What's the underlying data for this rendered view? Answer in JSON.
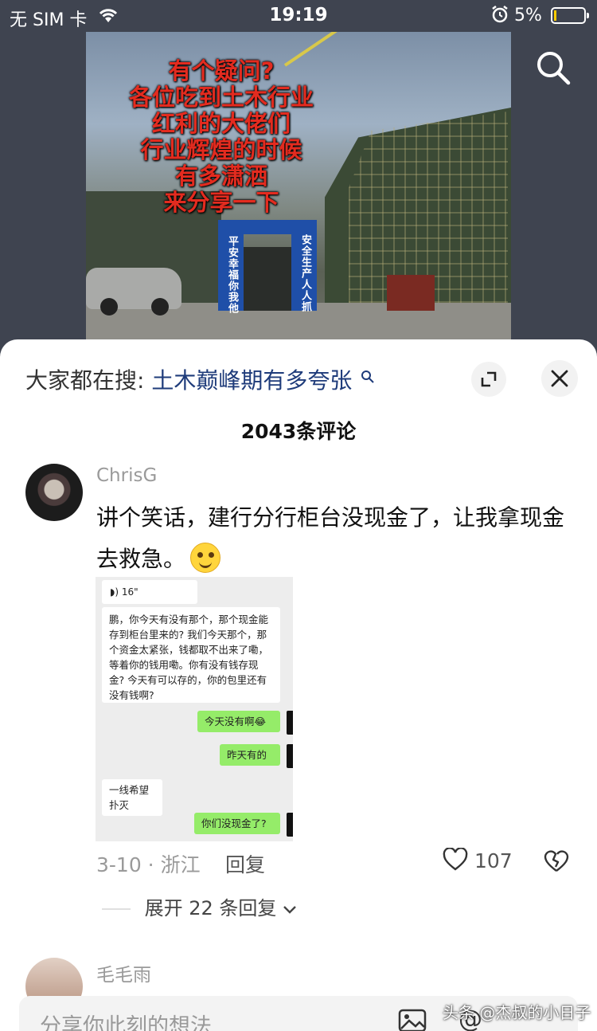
{
  "status_bar": {
    "carrier": "无 SIM 卡",
    "time": "19:19",
    "battery": "5%"
  },
  "post_image": {
    "overlay_lines": [
      "有个疑问?",
      "各位吃到土木行业",
      "红利的大佬们",
      "行业辉煌的时候",
      "有多潇洒",
      "来分享一下"
    ],
    "gate_left": "平安幸福你我他",
    "gate_right": "安全生产人人抓"
  },
  "sheet": {
    "search_prefix": "大家都在搜:",
    "search_term": "土木巅峰期有多夸张",
    "comment_count": "2043条评论"
  },
  "comment": {
    "username": "ChrisG",
    "text": "讲个笑话，建行分行柜台没现金了，让我拿现金去救急。",
    "date_location": "3-10 · 浙江",
    "reply_label": "回复",
    "likes": "107",
    "expand_replies": "展开 22 条回复"
  },
  "chat_screenshot": {
    "voice": "16\"",
    "message_1": "鹏，你今天有没有那个，那个现金能存到柜台里来的? 我们今天那个，那个资金太紧张，钱都取不出来了嘞，等着你的钱用嘞。你有没有钱存现金? 今天有可以存的，你的包里还有没有钱啊?",
    "reply_1": "今天没有啊😂",
    "reply_2": "昨天有的",
    "message_2": "一线希望扑灭",
    "reply_3": "你们没现金了?"
  },
  "comment_2": {
    "username": "毛毛雨"
  },
  "input": {
    "placeholder": "分享你此刻的想法"
  },
  "watermark": "头条 @杰叔的小日子"
}
